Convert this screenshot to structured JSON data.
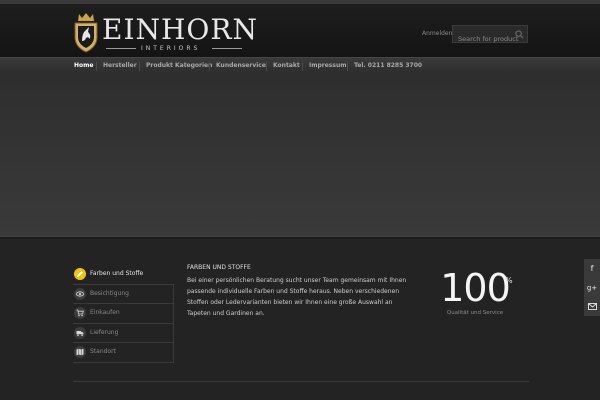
{
  "header": {
    "brand_name": "EINHORN",
    "brand_sub": "INTERIORS",
    "login_label": "Anmelden",
    "search_placeholder": "Search for product"
  },
  "nav": {
    "items": [
      {
        "label": "Home",
        "active": true
      },
      {
        "label": "Hersteller"
      },
      {
        "label": "Produkt Kategorien"
      },
      {
        "label": "Kundenservice"
      },
      {
        "label": "Kontakt"
      },
      {
        "label": "Impressum"
      },
      {
        "label": "Tel. 0211 8285 3700"
      }
    ]
  },
  "tabs": {
    "items": [
      {
        "label": "Farben und Stoffe",
        "icon": "pencil-icon",
        "active": true
      },
      {
        "label": "Besichtigung",
        "icon": "eye-icon"
      },
      {
        "label": "Einkaufen",
        "icon": "cart-icon"
      },
      {
        "label": "Lieferung",
        "icon": "truck-icon"
      },
      {
        "label": "Standort",
        "icon": "map-icon"
      }
    ],
    "active_heading": "FARBEN UND STOFFE",
    "active_text": "Bei einer persönlichen Beratung sucht unser Team gemeinsam mit Ihnen passende individuelle Farben und Stoffe heraus. Neben verschiedenen Stoffen oder Ledervarianten bieten wir Ihnen eine große Auswahl an Tapeten und Gardinen an."
  },
  "stat": {
    "value": "100",
    "unit": "%",
    "label": "Qualität und Service"
  },
  "social": {
    "facebook": "f",
    "googleplus": "g+"
  },
  "colors": {
    "accent": "#f1c40f",
    "background": "#232323"
  }
}
